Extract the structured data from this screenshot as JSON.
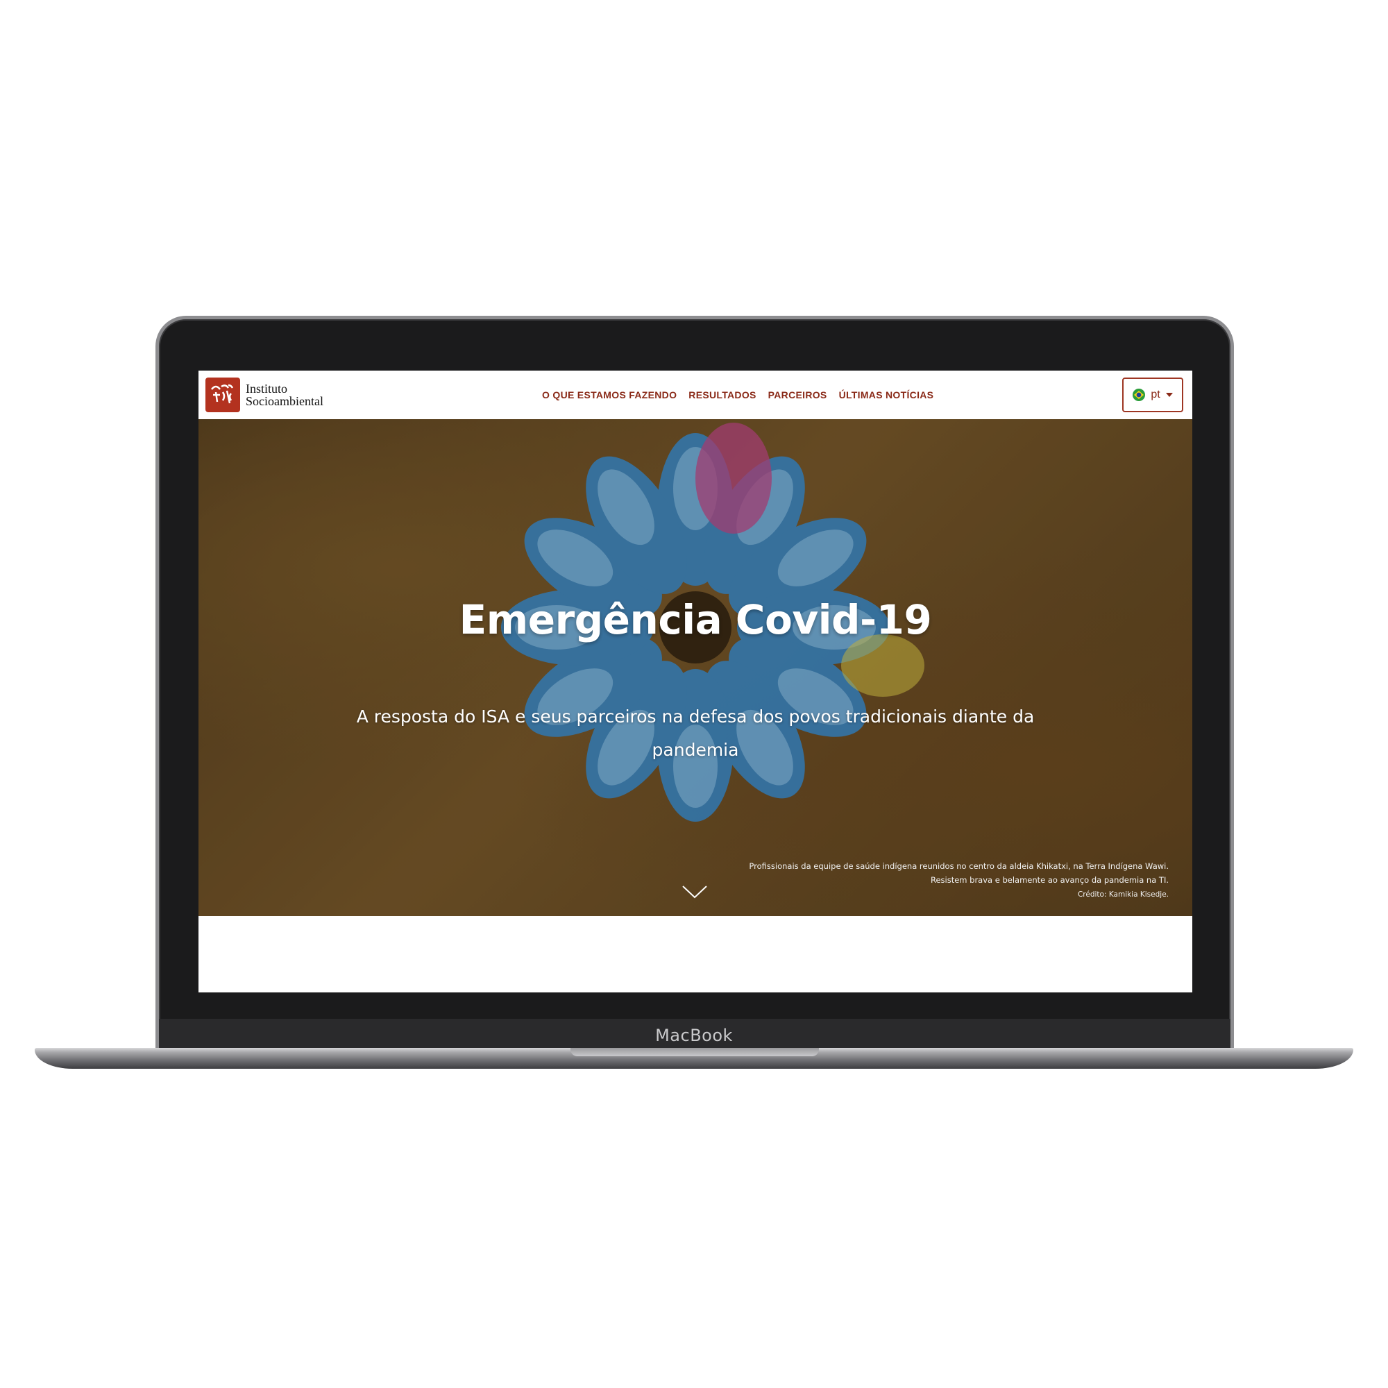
{
  "device": {
    "label": "MacBook"
  },
  "site": {
    "logo": {
      "line1": "Instituto",
      "line2": "Socioambiental"
    },
    "nav": [
      {
        "label": "O QUE ESTAMOS FAZENDO"
      },
      {
        "label": "RESULTADOS"
      },
      {
        "label": "PARCEIROS"
      },
      {
        "label": "ÚLTIMAS NOTÍCIAS"
      }
    ],
    "language": {
      "label": "pt",
      "flag": "brazil-flag-icon"
    },
    "colors": {
      "brand": "#8a2a18",
      "logo_bg": "#b3321f"
    }
  },
  "hero": {
    "title": "Emergência Covid-19",
    "subtitle": "A resposta do ISA e seus parceiros na defesa dos povos tradicionais diante da pandemia",
    "caption": "Profissionais da equipe de saúde indígena reunidos no centro da aldeia Khikatxi, na Terra Indígena Wawi. Resistem brava e belamente ao avanço da pandemia na TI.",
    "credit": "Crédito: Kamikia Kisedje."
  }
}
